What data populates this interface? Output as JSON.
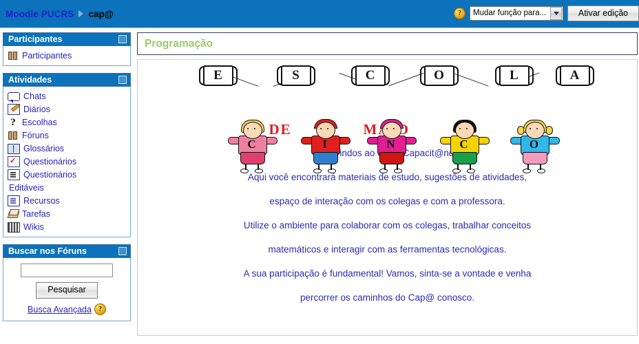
{
  "topbar": {
    "breadcrumb_root": "Moodle PUCRS",
    "breadcrumb_current": "cap@",
    "help_glyph": "?",
    "role_select_value": "Mudar função para...",
    "edit_button": "Ativar edição"
  },
  "sidebar": {
    "blocks": [
      {
        "title": "Participantes",
        "items": [
          {
            "label": "Participantes",
            "icon": "users-icon"
          }
        ]
      },
      {
        "title": "Atividades",
        "items": [
          {
            "label": "Chats",
            "icon": "chat-icon"
          },
          {
            "label": "Diários",
            "icon": "diary-icon"
          },
          {
            "label": "Escolhas",
            "icon": "question-mark-icon"
          },
          {
            "label": "Fóruns",
            "icon": "users-icon"
          },
          {
            "label": "Glossários",
            "icon": "book-icon"
          },
          {
            "label": "Questionários",
            "icon": "quiz-check-icon"
          },
          {
            "label": "Questionários",
            "icon": "quiz-list-icon"
          },
          {
            "label": "Editáveis",
            "icon": "none"
          },
          {
            "label": "Recursos",
            "icon": "document-icon"
          },
          {
            "label": "Tarefas",
            "icon": "assignment-icon"
          },
          {
            "label": "Wikis",
            "icon": "wiki-icon"
          }
        ]
      }
    ],
    "search_block": {
      "title": "Buscar nos Fóruns",
      "input_value": "",
      "input_placeholder": "",
      "button_label": "Pesquisar",
      "advanced_link": "Busca Avançada",
      "help_glyph": "?"
    }
  },
  "main": {
    "section_title": "Programação",
    "banner": {
      "word_letters": [
        "E",
        "S",
        "C",
        "O",
        "L",
        "A"
      ],
      "shirt_letters": [
        "C",
        "I",
        "N",
        "C",
        "O"
      ],
      "subtitle_left": "DE",
      "subtitle_right": "MAIO",
      "kids": [
        {
          "shirt": "#ef7f9f",
          "shorts": "#e2416f",
          "hair": "#f5d34a",
          "letter": "C",
          "hair_style": "bob"
        },
        {
          "shirt": "#e02020",
          "shorts": "#2f7fd0",
          "hair": "#e02020",
          "letter": "I",
          "hair_style": "cap"
        },
        {
          "shirt": "#e02090",
          "shorts": "#d01515",
          "hair": "#e02090",
          "letter": "N",
          "hair_style": "cap"
        },
        {
          "shirt": "#f5d300",
          "shorts": "#18a04a",
          "hair": "#111111",
          "letter": "C",
          "hair_style": "bob"
        },
        {
          "shirt": "#2fb8e8",
          "shorts": "#f49bc0",
          "hair": "#f5d34a",
          "letter": "O",
          "hair_style": "pigtails"
        }
      ]
    },
    "welcome_lines": [
      "Bem-vindos ao curso Capacit@ndo.",
      "Aqui você encontrará materiais de estudo, sugestões de atividades,",
      "espaço de interação com os colegas e com a professora.",
      "Utilize o ambiente para  colaborar com os colegas, trabalhar conceitos",
      "matemáticos e interagir com as ferramentas tecnológicas.",
      "A sua participação é fundamental! Vamos, sinta-se a vontade e venha",
      "percorrer os caminhos do Cap@ conosco."
    ]
  },
  "colors": {
    "nav_blue": "#0b72bb",
    "link_blue": "#2424b8",
    "title_green": "#9ccb6a",
    "text_blue": "#2b2bb5",
    "accent_red": "#e01b1b"
  }
}
